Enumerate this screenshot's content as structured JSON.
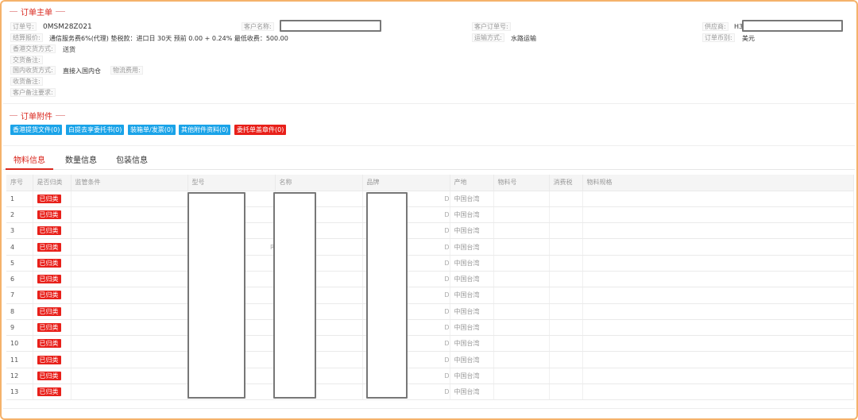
{
  "order_main": {
    "title": "订单主单",
    "order_no_label": "订单号:",
    "order_no": "0MSM28Z021",
    "customer_name_label": "客户名称:",
    "customer_order_no_label": "客户订单号:",
    "supplier_label": "供应商:",
    "supplier_value_prefix": "H3",
    "pricing_label": "结算报价:",
    "pricing_value": "通信服务费6%(代理) 垫税款：进口日 30天 预前 0.00 + 0.24% 最低收费：500.00",
    "transport_label": "运输方式:",
    "transport_value": "水路运输",
    "currency_label": "订单币别:",
    "currency_value": "美元",
    "hk_delivery_label": "香港交货方式:",
    "hk_delivery_value": "送货",
    "delivery_note_label": "交货备注:",
    "domestic_delivery_label": "国内收货方式:",
    "domestic_delivery_value": "直接入国内仓",
    "logistics_fee_label": "物流费用:",
    "receiving_note_label": "收货备注:",
    "customer_note_label": "客户备注要求:"
  },
  "attachments": {
    "title": "订单附件",
    "buttons": [
      {
        "label": "香港提货文件(0)",
        "color": "#1aa3e8"
      },
      {
        "label": "白提去享委托书(0)",
        "color": "#1aa3e8"
      },
      {
        "label": "装箱单/发票(0)",
        "color": "#1aa3e8"
      },
      {
        "label": "其他附件资料(0)",
        "color": "#1aa3e8"
      },
      {
        "label": "委托单盖章件(0)",
        "color": "#e8201a"
      }
    ]
  },
  "tabs": [
    {
      "label": "物料信息",
      "active": true
    },
    {
      "label": "数量信息",
      "active": false
    },
    {
      "label": "包装信息",
      "active": false
    }
  ],
  "table": {
    "headers": [
      "序号",
      "是否归类",
      "监管条件",
      "型号",
      "名称",
      "品牌",
      "产地",
      "物料号",
      "消费税",
      "物料规格"
    ],
    "rows": [
      {
        "no": "1",
        "status": "已归类",
        "origin": "中国台湾",
        "frag_model": "",
        "frag_brand": "D"
      },
      {
        "no": "2",
        "status": "已归类",
        "origin": "中国台湾",
        "frag_model": "",
        "frag_brand": "D"
      },
      {
        "no": "3",
        "status": "已归类",
        "origin": "中国台湾",
        "frag_model": "",
        "frag_brand": "D"
      },
      {
        "no": "4",
        "status": "已归类",
        "origin": "中国台湾",
        "frag_model": "R",
        "frag_brand": "D"
      },
      {
        "no": "5",
        "status": "已归类",
        "origin": "中国台湾",
        "frag_model": "",
        "frag_brand": "D"
      },
      {
        "no": "6",
        "status": "已归类",
        "origin": "中国台湾",
        "frag_model": "",
        "frag_brand": "D"
      },
      {
        "no": "7",
        "status": "已归类",
        "origin": "中国台湾",
        "frag_model": "",
        "frag_brand": "D"
      },
      {
        "no": "8",
        "status": "已归类",
        "origin": "中国台湾",
        "frag_model": "",
        "frag_brand": "D"
      },
      {
        "no": "9",
        "status": "已归类",
        "origin": "中国台湾",
        "frag_model": "",
        "frag_brand": "D"
      },
      {
        "no": "10",
        "status": "已归类",
        "origin": "中国台湾",
        "frag_model": "",
        "frag_brand": "D"
      },
      {
        "no": "11",
        "status": "已归类",
        "origin": "中国台湾",
        "frag_model": "",
        "frag_brand": "D"
      },
      {
        "no": "12",
        "status": "已归类",
        "origin": "中国台湾",
        "frag_model": "",
        "frag_brand": "D"
      },
      {
        "no": "13",
        "status": "已归类",
        "origin": "中国台湾",
        "frag_model": "",
        "frag_brand": "D"
      }
    ]
  },
  "colors": {
    "accent_red": "#d9261c",
    "badge_red": "#e8201a",
    "button_blue": "#1aa3e8",
    "frame_orange": "#f5b26b"
  }
}
